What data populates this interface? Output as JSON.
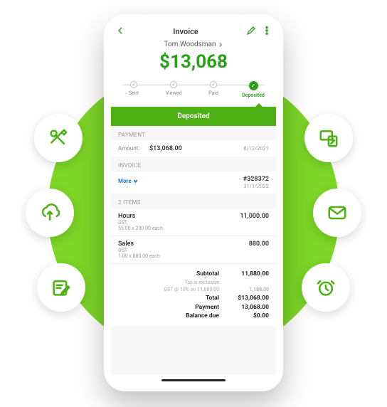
{
  "colors": {
    "accent": "#2ca01c",
    "banner": "#4db014",
    "bubble_bg": "#7cd626"
  },
  "header": {
    "title": "Invoice",
    "customer": "Tom Woodsman",
    "amount": "$13,068"
  },
  "progress": [
    {
      "label": "Sent",
      "done": true
    },
    {
      "label": "Viewed",
      "done": true
    },
    {
      "label": "Paid",
      "done": true
    },
    {
      "label": "Deposited",
      "active": true
    }
  ],
  "banner": {
    "label": "Deposited"
  },
  "payment": {
    "heading": "PAYMENT",
    "amount_label": "Amount:",
    "amount": "$13,068.00",
    "date": "8/12/2021"
  },
  "invoice": {
    "heading": "INVOICE",
    "number": "#328372",
    "date": "31/1/2022",
    "more_label": "More"
  },
  "items": {
    "heading": "2 ITEMS",
    "list": [
      {
        "name": "Hours",
        "tax": "GST",
        "detail": "55.00 x 200.00 each",
        "price": "11,000.00"
      },
      {
        "name": "Sales",
        "tax": "GST",
        "detail": "1.00 x 880.00 each",
        "price": "880.00"
      }
    ]
  },
  "totals": {
    "subtotal_label": "Subtotal",
    "subtotal": "11,880.00",
    "tax_note_label": "Tax is exclusive",
    "tax_label": "GST @ 10% on 11,880.00",
    "tax": "1,188.00",
    "total_label": "Total",
    "total": "$13,068.00",
    "payment_label": "Payment",
    "payment": "13,068.00",
    "balance_label": "Balance due",
    "balance": "$0.00"
  },
  "bubbles": {
    "left": [
      "tools-icon",
      "cloud-upload-icon",
      "note-edit-icon"
    ],
    "right": [
      "screens-icon",
      "mail-icon",
      "clock-icon"
    ]
  }
}
